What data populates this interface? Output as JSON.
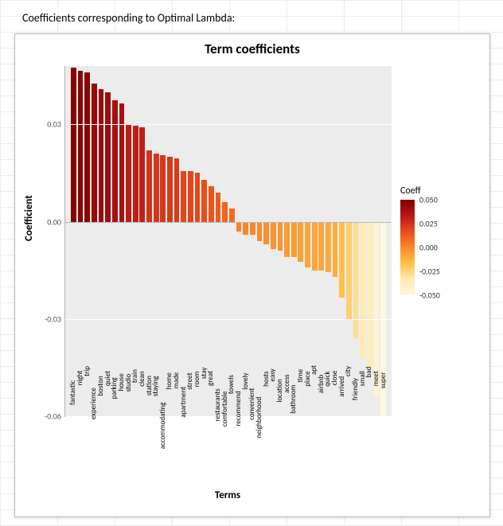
{
  "heading": "Coefficients corresponding to Optimal Lambda:",
  "chart_data": {
    "type": "bar",
    "title": "Term coefficients",
    "xlabel": "Terms",
    "ylabel": "Coefficient",
    "ylim": [
      -0.06,
      0.048
    ],
    "yticks": [
      0.03,
      0.0,
      -0.03,
      -0.06
    ],
    "legend_title": "Coeff",
    "legend_ticks": [
      0.05,
      0.025,
      0.0,
      -0.025,
      -0.05
    ],
    "categories": [
      "fantastic",
      "night",
      "trip",
      "experience",
      "boston",
      "quiet",
      "parking",
      "house",
      "studio",
      "train",
      "clean",
      "station",
      "staying",
      "accommodating",
      "home",
      "made",
      "apartment",
      "street",
      "room",
      "stay",
      "great",
      "restaurants",
      "comfortable",
      "towels",
      "recommend",
      "lovely",
      "convenient",
      "neighborhood",
      "hosts",
      "easy",
      "location",
      "access",
      "bathroom",
      "time",
      "place",
      "apt",
      "airbnb",
      "quick",
      "close",
      "arrived",
      "city",
      "friendly",
      "small",
      "bad",
      "meet",
      "super"
    ],
    "values": [
      0.0475,
      0.0465,
      0.046,
      0.0425,
      0.041,
      0.04,
      0.0375,
      0.0365,
      0.03,
      0.0295,
      0.029,
      0.022,
      0.021,
      0.0205,
      0.02,
      0.0195,
      0.0155,
      0.0155,
      0.015,
      0.013,
      0.011,
      0.009,
      0.006,
      0.004,
      -0.003,
      -0.004,
      -0.004,
      -0.006,
      -0.007,
      -0.0085,
      -0.009,
      -0.011,
      -0.011,
      -0.0125,
      -0.014,
      -0.015,
      -0.015,
      -0.0155,
      -0.017,
      -0.0235,
      -0.03,
      -0.036,
      -0.042,
      -0.045,
      -0.054,
      -0.06
    ]
  }
}
